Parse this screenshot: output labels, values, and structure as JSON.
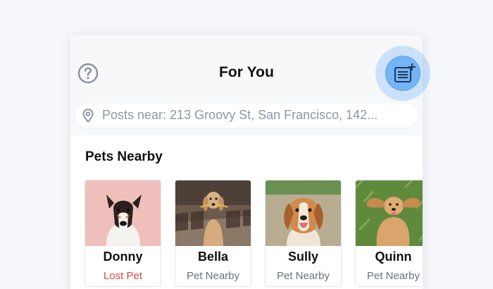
{
  "header": {
    "title": "For You",
    "help_icon": "question-circle-icon",
    "compose_icon": "new-post-icon"
  },
  "search": {
    "location_icon": "map-pin-icon",
    "text": "Posts near: 213 Groovy St, San Francisco, 142..."
  },
  "pets_nearby": {
    "title": "Pets Nearby",
    "cards": [
      {
        "name": "Donny",
        "status": "Lost Pet",
        "status_color": "#e2463f"
      },
      {
        "name": "Bella",
        "status": "Pet Nearby",
        "status_color": "#6b717c"
      },
      {
        "name": "Sully",
        "status": "Pet Nearby",
        "status_color": "#6b717c"
      },
      {
        "name": "Quinn",
        "status": "Pet Nearby",
        "status_color": "#6b717c"
      }
    ]
  },
  "colors": {
    "accent": "#74b4f5",
    "lost": "#e2463f",
    "background": "#f5f7fb"
  }
}
